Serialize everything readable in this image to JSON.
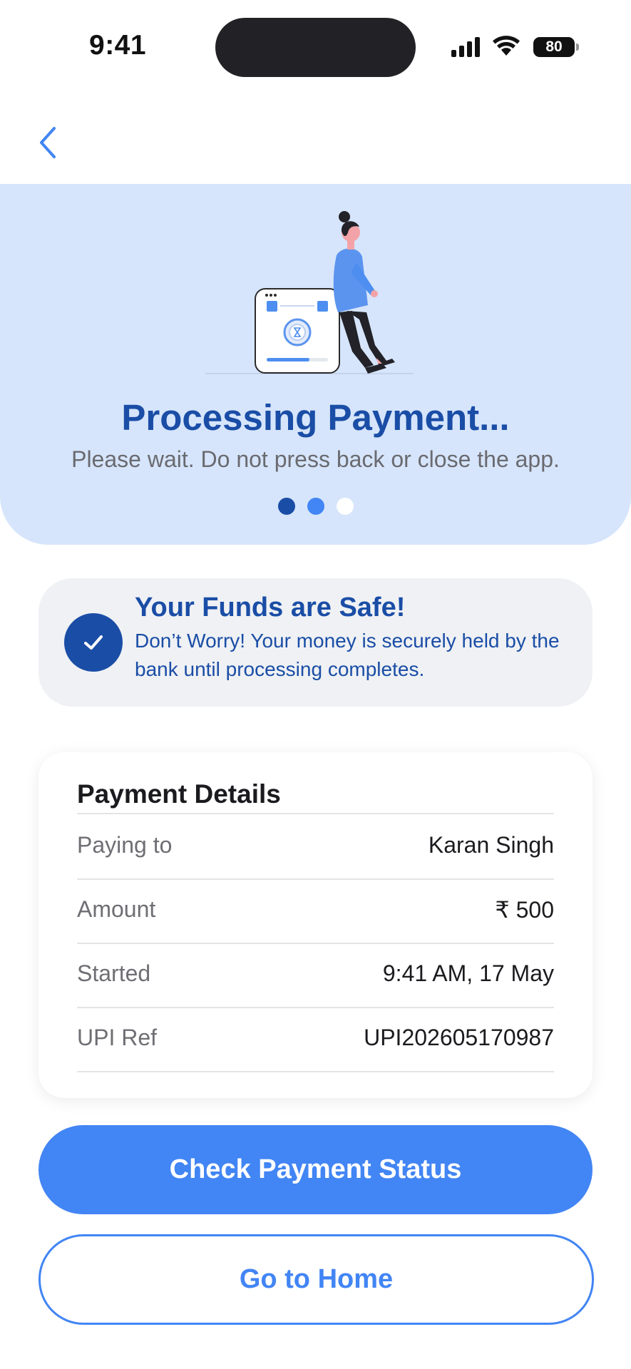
{
  "status_bar": {
    "time": "9:41",
    "battery": "80",
    "icons": [
      "signal-icon",
      "wifi-icon",
      "battery-icon"
    ]
  },
  "nav": {
    "back_icon": "chevron-left-icon"
  },
  "hero": {
    "title": "Processing Payment...",
    "subtitle": "Please wait. Do not press back or close the app.",
    "illustration": "woman-leaning-on-phone-hourglass-illustration",
    "dots_active": 2,
    "dots_total": 3
  },
  "safe_notice": {
    "icon": "check-icon",
    "title": "Your Funds are Safe!",
    "text": "Don’t Worry! Your money is securely held by the bank until processing completes."
  },
  "details": {
    "title": "Payment Details",
    "rows": [
      {
        "label": "Paying to",
        "value": "Karan Singh"
      },
      {
        "label": "Amount",
        "value": "₹ 500"
      },
      {
        "label": "Started",
        "value": "9:41 AM, 17 May"
      },
      {
        "label": "UPI Ref",
        "value": "UPI202605170987"
      }
    ]
  },
  "actions": {
    "primary_label": "Check Payment Status",
    "secondary_label": "Go to Home"
  },
  "colors": {
    "accent": "#4285f4",
    "brand_dark": "#1a4da6",
    "hero_bg": "#d6e5fb",
    "notice_bg": "#eff1f4"
  }
}
